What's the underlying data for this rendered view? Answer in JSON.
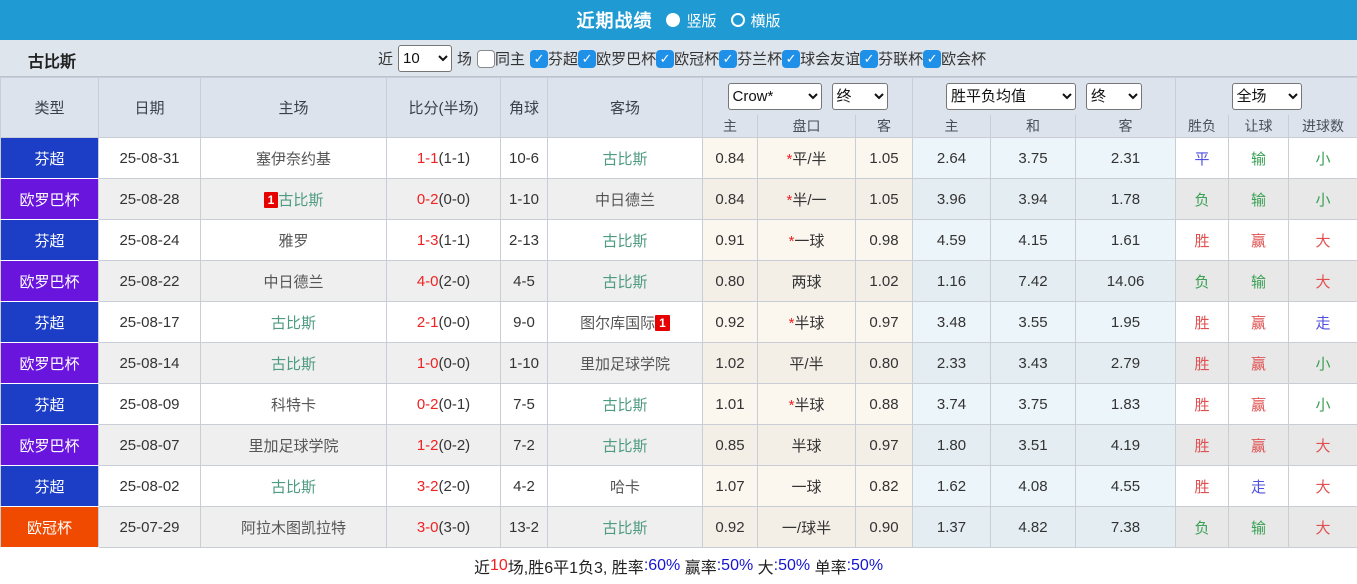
{
  "colors": {
    "topbar_blue": "#1f9ad2",
    "checkbox_blue": "#1e90e8",
    "type_fin_super": "#1c3dc6",
    "type_europa": "#6a15dd",
    "type_ucl": "#f04a00",
    "score_red": "#f02222",
    "self_team_green": "#4d9b82",
    "red": "#e05050",
    "green": "#3aa054",
    "blue": "#4f4fe0",
    "footer_black": "#222222",
    "footer_blue": "#1414d2",
    "footer_red": "#f02222"
  },
  "title_bar": {
    "title": "近期战绩",
    "radio_vertical": "竖版",
    "radio_horizontal": "横版",
    "vertical_selected": true
  },
  "filter": {
    "team": "古比斯",
    "near_label": "近",
    "rounds_value": "10",
    "rounds_suffix": "场",
    "same_home_label": "同主",
    "same_home_checked": false,
    "leagues": [
      {
        "label": "芬超",
        "checked": true
      },
      {
        "label": "欧罗巴杯",
        "checked": true
      },
      {
        "label": "欧冠杯",
        "checked": true
      },
      {
        "label": "芬兰杯",
        "checked": true
      },
      {
        "label": "球会友谊",
        "checked": true
      },
      {
        "label": "芬联杯",
        "checked": true
      },
      {
        "label": "欧会杯",
        "checked": true
      }
    ]
  },
  "table": {
    "main_headers": [
      "类型",
      "日期",
      "主场",
      "比分(半场)",
      "角球",
      "客场"
    ],
    "selects": {
      "company": "Crow*",
      "company_time": "终",
      "avg": "胜平负均值",
      "avg_time": "终",
      "scope": "全场"
    },
    "sub_headers": [
      "主",
      "盘口",
      "客",
      "主",
      "和",
      "客",
      "胜负",
      "让球",
      "进球数"
    ],
    "rows": [
      {
        "type": "芬超",
        "type_key": "type_fin_super",
        "date": "25-08-31",
        "home": "塞伊奈约基",
        "home_self": false,
        "home_badge": "",
        "away": "古比斯",
        "away_self": true,
        "away_badge": "",
        "score": "1-1",
        "half": "(1-1)",
        "corner": "10-6",
        "crow_star": true,
        "crow": [
          "0.84",
          "平/半",
          "1.05"
        ],
        "avg": [
          "2.64",
          "3.75",
          "2.31"
        ],
        "res": [
          [
            "平",
            "blue"
          ],
          [
            "输",
            "green"
          ],
          [
            "小",
            "green"
          ]
        ]
      },
      {
        "type": "欧罗巴杯",
        "type_key": "type_europa",
        "date": "25-08-28",
        "home": "古比斯",
        "home_self": true,
        "home_badge": "1",
        "away": "中日德兰",
        "away_self": false,
        "away_badge": "",
        "score": "0-2",
        "half": "(0-0)",
        "corner": "1-10",
        "crow_star": true,
        "crow": [
          "0.84",
          "半/一",
          "1.05"
        ],
        "avg": [
          "3.96",
          "3.94",
          "1.78"
        ],
        "res": [
          [
            "负",
            "green"
          ],
          [
            "输",
            "green"
          ],
          [
            "小",
            "green"
          ]
        ]
      },
      {
        "type": "芬超",
        "type_key": "type_fin_super",
        "date": "25-08-24",
        "home": "雅罗",
        "home_self": false,
        "home_badge": "",
        "away": "古比斯",
        "away_self": true,
        "away_badge": "",
        "score": "1-3",
        "half": "(1-1)",
        "corner": "2-13",
        "crow_star": true,
        "crow": [
          "0.91",
          "一球",
          "0.98"
        ],
        "avg": [
          "4.59",
          "4.15",
          "1.61"
        ],
        "res": [
          [
            "胜",
            "red"
          ],
          [
            "赢",
            "red"
          ],
          [
            "大",
            "red"
          ]
        ]
      },
      {
        "type": "欧罗巴杯",
        "type_key": "type_europa",
        "date": "25-08-22",
        "home": "中日德兰",
        "home_self": false,
        "home_badge": "",
        "away": "古比斯",
        "away_self": true,
        "away_badge": "",
        "score": "4-0",
        "half": "(2-0)",
        "corner": "4-5",
        "crow_star": false,
        "crow": [
          "0.80",
          "两球",
          "1.02"
        ],
        "avg": [
          "1.16",
          "7.42",
          "14.06"
        ],
        "res": [
          [
            "负",
            "green"
          ],
          [
            "输",
            "green"
          ],
          [
            "大",
            "red"
          ]
        ]
      },
      {
        "type": "芬超",
        "type_key": "type_fin_super",
        "date": "25-08-17",
        "home": "古比斯",
        "home_self": true,
        "home_badge": "",
        "away": "图尔库国际",
        "away_self": false,
        "away_badge": "1",
        "score": "2-1",
        "half": "(0-0)",
        "corner": "9-0",
        "crow_star": true,
        "crow": [
          "0.92",
          "半球",
          "0.97"
        ],
        "avg": [
          "3.48",
          "3.55",
          "1.95"
        ],
        "res": [
          [
            "胜",
            "red"
          ],
          [
            "赢",
            "red"
          ],
          [
            "走",
            "blue"
          ]
        ]
      },
      {
        "type": "欧罗巴杯",
        "type_key": "type_europa",
        "date": "25-08-14",
        "home": "古比斯",
        "home_self": true,
        "home_badge": "",
        "away": "里加足球学院",
        "away_self": false,
        "away_badge": "",
        "score": "1-0",
        "half": "(0-0)",
        "corner": "1-10",
        "crow_star": false,
        "crow": [
          "1.02",
          "平/半",
          "0.80"
        ],
        "avg": [
          "2.33",
          "3.43",
          "2.79"
        ],
        "res": [
          [
            "胜",
            "red"
          ],
          [
            "赢",
            "red"
          ],
          [
            "小",
            "green"
          ]
        ]
      },
      {
        "type": "芬超",
        "type_key": "type_fin_super",
        "date": "25-08-09",
        "home": "科特卡",
        "home_self": false,
        "home_badge": "",
        "away": "古比斯",
        "away_self": true,
        "away_badge": "",
        "score": "0-2",
        "half": "(0-1)",
        "corner": "7-5",
        "crow_star": true,
        "crow": [
          "1.01",
          "半球",
          "0.88"
        ],
        "avg": [
          "3.74",
          "3.75",
          "1.83"
        ],
        "res": [
          [
            "胜",
            "red"
          ],
          [
            "赢",
            "red"
          ],
          [
            "小",
            "green"
          ]
        ]
      },
      {
        "type": "欧罗巴杯",
        "type_key": "type_europa",
        "date": "25-08-07",
        "home": "里加足球学院",
        "home_self": false,
        "home_badge": "",
        "away": "古比斯",
        "away_self": true,
        "away_badge": "",
        "score": "1-2",
        "half": "(0-2)",
        "corner": "7-2",
        "crow_star": false,
        "crow": [
          "0.85",
          "半球",
          "0.97"
        ],
        "avg": [
          "1.80",
          "3.51",
          "4.19"
        ],
        "res": [
          [
            "胜",
            "red"
          ],
          [
            "赢",
            "red"
          ],
          [
            "大",
            "red"
          ]
        ]
      },
      {
        "type": "芬超",
        "type_key": "type_fin_super",
        "date": "25-08-02",
        "home": "古比斯",
        "home_self": true,
        "home_badge": "",
        "away": "哈卡",
        "away_self": false,
        "away_badge": "",
        "score": "3-2",
        "half": "(2-0)",
        "corner": "4-2",
        "crow_star": false,
        "crow": [
          "1.07",
          "一球",
          "0.82"
        ],
        "avg": [
          "1.62",
          "4.08",
          "4.55"
        ],
        "res": [
          [
            "胜",
            "red"
          ],
          [
            "走",
            "blue"
          ],
          [
            "大",
            "red"
          ]
        ]
      },
      {
        "type": "欧冠杯",
        "type_key": "type_ucl",
        "date": "25-07-29",
        "home": "阿拉木图凯拉特",
        "home_self": false,
        "home_badge": "",
        "away": "古比斯",
        "away_self": true,
        "away_badge": "",
        "score": "3-0",
        "half": "(3-0)",
        "corner": "13-2",
        "crow_star": false,
        "crow": [
          "0.92",
          "一/球半",
          "0.90"
        ],
        "avg": [
          "1.37",
          "4.82",
          "7.38"
        ],
        "res": [
          [
            "负",
            "green"
          ],
          [
            "输",
            "green"
          ],
          [
            "大",
            "red"
          ]
        ]
      }
    ]
  },
  "footer": {
    "segments": [
      {
        "text": "近",
        "color": "black"
      },
      {
        "text": "10",
        "color": "red"
      },
      {
        "text": "场,胜6平1负3, 胜率",
        "color": "black"
      },
      {
        "text": ":60%",
        "color": "blue"
      },
      {
        "text": " 赢率",
        "color": "black"
      },
      {
        "text": ":50%",
        "color": "blue"
      },
      {
        "text": " 大",
        "color": "black"
      },
      {
        "text": ":50%",
        "color": "blue"
      },
      {
        "text": " 单率",
        "color": "black"
      },
      {
        "text": ":50%",
        "color": "blue"
      }
    ]
  }
}
